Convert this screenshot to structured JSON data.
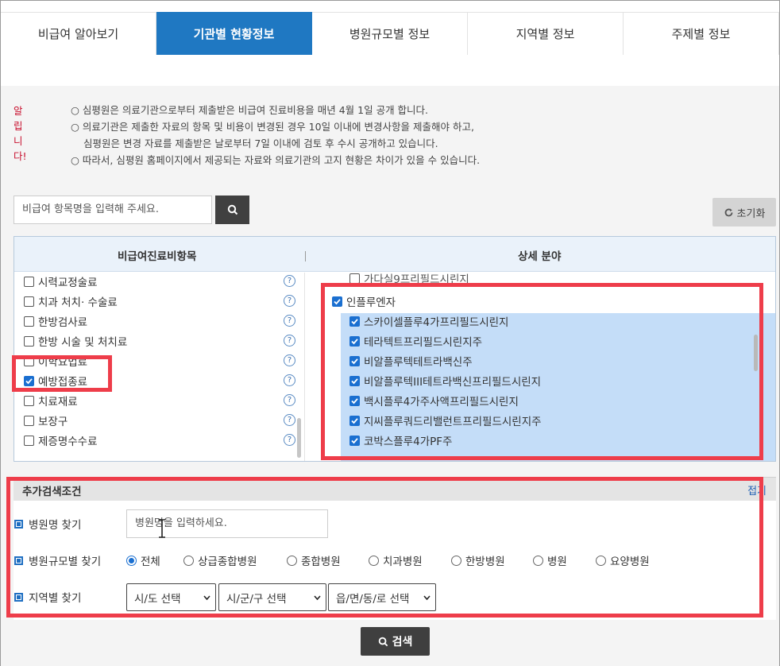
{
  "tabs": [
    {
      "label": "비급여 알아보기",
      "active": false
    },
    {
      "label": "기관별 현황정보",
      "active": true
    },
    {
      "label": "병원규모별 정보",
      "active": false
    },
    {
      "label": "지역별 정보",
      "active": false
    },
    {
      "label": "주제별 정보",
      "active": false
    }
  ],
  "notice": {
    "label": "알립니다!",
    "lines": [
      "○ 심평원은 의료기관으로부터 제출받은 비급여 진료비용을 매년 4월 1일 공개 합니다.",
      "○ 의료기관은 제출한 자료의 항목 및 비용이 변경된 경우 10일 이내에 변경사항을 제출해야 하고,",
      "심평원은 변경 자료를 제출받은 날로부터 7일 이내에 검토 후 수시 공개하고 있습니다.",
      "○ 따라서, 심평원 홈페이지에서 제공되는 자료와 의료기관의 고지 현황은 차이가 있을 수 있습니다."
    ]
  },
  "search": {
    "placeholder": "비급여 항목명을 입력해 주세요."
  },
  "reset_label": "초기화",
  "panel": {
    "left_header": "비급여진료비항목",
    "right_header": "상세 분야",
    "categories": [
      {
        "label": "시력교정술료",
        "checked": false
      },
      {
        "label": "치과 처치· 수술료",
        "checked": false
      },
      {
        "label": "한방검사료",
        "checked": false
      },
      {
        "label": "한방 시술 및 처치료",
        "checked": false
      },
      {
        "label": "이학요법료",
        "checked": false
      },
      {
        "label": "예방접종료",
        "checked": true
      },
      {
        "label": "치료재료",
        "checked": false
      },
      {
        "label": "보장구",
        "checked": false
      },
      {
        "label": "제증명수수료",
        "checked": false
      }
    ],
    "help_glyph": "?",
    "top_partial_item": "가다실9프리필드시린지",
    "group": {
      "label": "인플루엔자",
      "checked": true
    },
    "details": [
      "스카이셀플루4가프리필드시린지",
      "테라텍트프리필드시린지주",
      "비알플루텍테트라백신주",
      "비알플루텍III테트라백신프리필드시린지",
      "백시플루4가주사액프리필드시린지",
      "지씨플루쿼드리밸런트프리필드시린지주",
      "코박스플루4가PF주"
    ]
  },
  "additional": {
    "title": "추가검색조건",
    "fold_label": "접기",
    "hospital_name_label": "병원명 찾기",
    "hospital_name_placeholder": "병원명을 입력하세요.",
    "size_label": "병원규모별 찾기",
    "size_options": [
      {
        "label": "전체",
        "selected": true
      },
      {
        "label": "상급종합병원",
        "selected": false
      },
      {
        "label": "종합병원",
        "selected": false
      },
      {
        "label": "치과병원",
        "selected": false
      },
      {
        "label": "한방병원",
        "selected": false
      },
      {
        "label": "병원",
        "selected": false
      },
      {
        "label": "요양병원",
        "selected": false
      }
    ],
    "region_label": "지역별 찾기",
    "region_selects": [
      "시/도 선택",
      "시/군/구 선택",
      "읍/면/동/로 선택"
    ]
  },
  "search_button_label": "검색",
  "colors": {
    "active_tab": "#1f78c2",
    "highlight": "#ee3d4a",
    "selection": "#c4ddf8",
    "notice": "#c8102e"
  }
}
